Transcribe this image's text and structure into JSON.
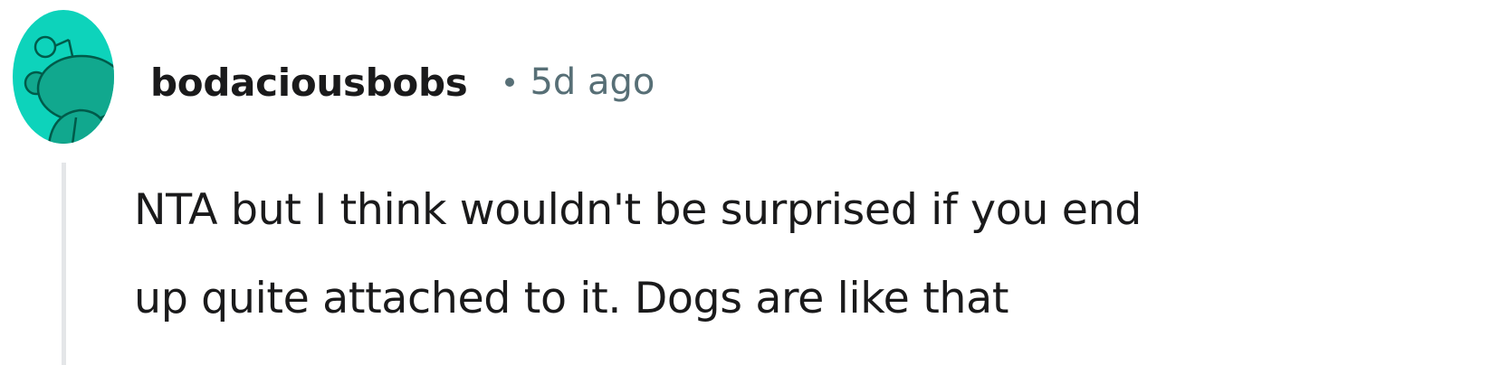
{
  "comment": {
    "avatar_icon": "reddit-snoo-avatar-icon",
    "avatar_color": "#0dd3bb",
    "author": "bodaciousbobs",
    "separator": "•",
    "timestamp": "5d ago",
    "body_lines": [
      "NTA but I think wouldn't be surprised if you end",
      "up quite attached to it. Dogs are like that"
    ]
  }
}
